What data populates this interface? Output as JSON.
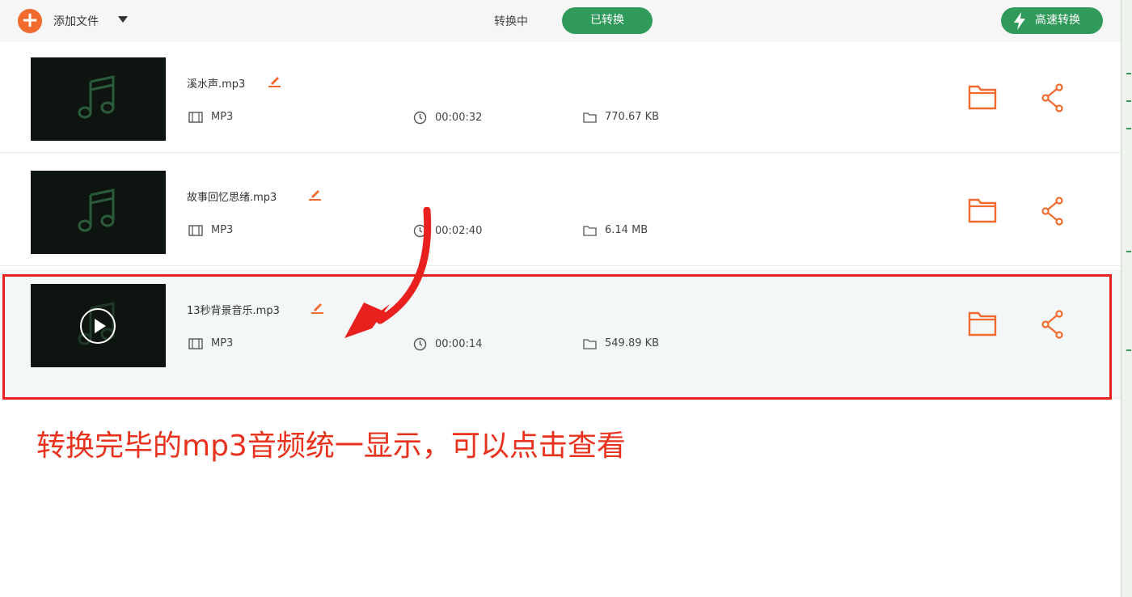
{
  "toolbar": {
    "add_label": "添加文件",
    "tab_converting": "转换中",
    "tab_converted": "已转换",
    "fast_convert": "高速转换"
  },
  "files": [
    {
      "name": "溪水声.mp3",
      "format": "MP3",
      "duration": "00:00:32",
      "size": "770.67 KB"
    },
    {
      "name": "故事回忆思绪.mp3",
      "format": "MP3",
      "duration": "00:02:40",
      "size": "6.14 MB"
    },
    {
      "name": "13秒背景音乐.mp3",
      "format": "MP3",
      "duration": "00:00:14",
      "size": "549.89 KB"
    }
  ],
  "annotation": {
    "text": "转换完毕的mp3音频统一显示，可以点击查看"
  },
  "colors": {
    "accent_orange": "#f26b2e",
    "brand_green": "#2f9a5a",
    "annotation_red": "#e8201e"
  },
  "icons": [
    "plus-icon",
    "chevron-down-icon",
    "lightning-icon",
    "music-note-icon",
    "play-icon",
    "edit-icon",
    "film-icon",
    "clock-icon",
    "folder-icon",
    "share-icon"
  ]
}
